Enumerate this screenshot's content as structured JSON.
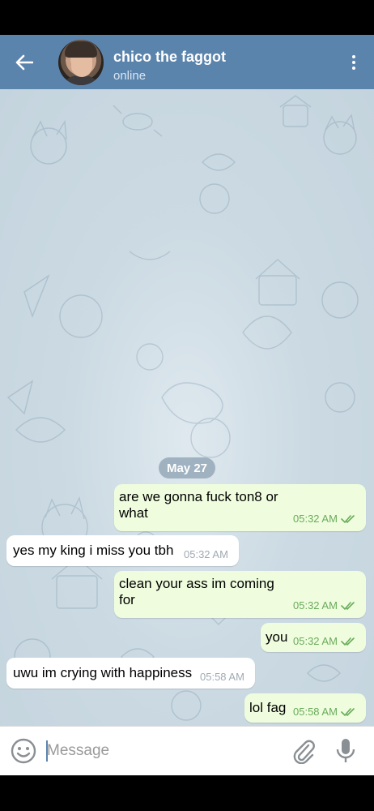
{
  "header": {
    "title": "chico the faggot",
    "status": "online",
    "back_icon": "arrow-left-icon",
    "menu_icon": "more-vertical-icon"
  },
  "chat": {
    "date_label": "May 27",
    "messages": [
      {
        "direction": "out",
        "text": "are we gonna fuck ton8 or\nwhat",
        "time": "05:32 AM",
        "read": true
      },
      {
        "direction": "in",
        "text": "yes my king i miss you tbh",
        "time": "05:32 AM"
      },
      {
        "direction": "out",
        "text": "clean your ass im coming\nfor",
        "time": "05:32 AM",
        "read": true
      },
      {
        "direction": "out",
        "text": "you",
        "time": "05:32 AM",
        "read": true
      },
      {
        "direction": "in",
        "text": "uwu im crying with happiness",
        "time": "05:58 AM"
      },
      {
        "direction": "out",
        "text": "lol fag",
        "time": "05:58 AM",
        "read": true
      }
    ]
  },
  "composer": {
    "placeholder": "Message",
    "emoji_icon": "emoji-smile-icon",
    "attach_icon": "paperclip-icon",
    "mic_icon": "microphone-icon"
  },
  "colors": {
    "header_bg": "#5b84ad",
    "out_bubble": "#effdde",
    "in_bubble": "#ffffff",
    "tick_color": "#6aab5b"
  }
}
